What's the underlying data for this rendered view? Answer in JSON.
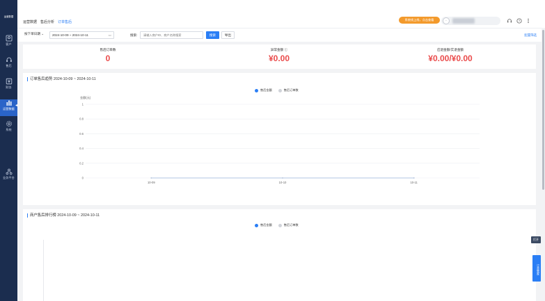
{
  "sidebar": {
    "logo": "运营数据",
    "items": [
      {
        "label": "客户",
        "icon": "user-frame-icon"
      },
      {
        "label": "售后",
        "icon": "headset-icon"
      },
      {
        "label": "财务",
        "icon": "finance-icon"
      },
      {
        "label": "运营数据",
        "icon": "bar-chart-icon"
      },
      {
        "label": "系统",
        "icon": "gear-icon"
      },
      {
        "label": "业务平台",
        "icon": "network-icon"
      }
    ]
  },
  "breadcrumb": {
    "items": [
      "运营数据",
      "售后分析",
      "订单售后"
    ]
  },
  "header": {
    "promo": "系统线上线，点击查看",
    "user_initial": "·"
  },
  "filters": {
    "type_select": "按下单日期",
    "date_range": "2024-10-09 ~ 2024-10-11",
    "search_label": "搜索:",
    "search_placeholder": "请输入商户ID、商户名称搜索",
    "search_button": "搜索",
    "export_button": "导出",
    "right_link": "配置筛选"
  },
  "stats": [
    {
      "title": "售后订单数",
      "value": "0"
    },
    {
      "title": "异常金额",
      "value": "¥0.00"
    },
    {
      "title": "应退金额/实退金额",
      "value": "¥0.00/¥0.00"
    }
  ],
  "trend_card": {
    "title": "订单售后趋势 2024-10-09 ~ 2024-10-11",
    "legend": [
      {
        "name": "售后金额",
        "color": "#2a7ef5"
      },
      {
        "name": "售后订单数",
        "color": "#d0d3d9"
      }
    ]
  },
  "rank_card": {
    "title": "商户售后排行榜 2024-10-09 ~ 2024-10-11",
    "legend": [
      {
        "name": "售后金额",
        "color": "#2a7ef5"
      },
      {
        "name": "售后订单数",
        "color": "#d0d3d9"
      }
    ]
  },
  "chart_data": {
    "type": "line",
    "ylabel": "金额(元)",
    "ylim": [
      0,
      1
    ],
    "yticks": [
      "0",
      "0.2",
      "0.4",
      "0.6",
      "0.8",
      "1"
    ],
    "categories": [
      "10-09",
      "10-10",
      "10-11"
    ],
    "series": [
      {
        "name": "售后金额",
        "values": [
          0,
          0,
          0
        ]
      },
      {
        "name": "售后订单数",
        "values": [
          0,
          0,
          0
        ]
      }
    ],
    "grid": true,
    "legend_position": "top-center"
  },
  "float_tags": [
    "打开",
    "订单管家"
  ]
}
